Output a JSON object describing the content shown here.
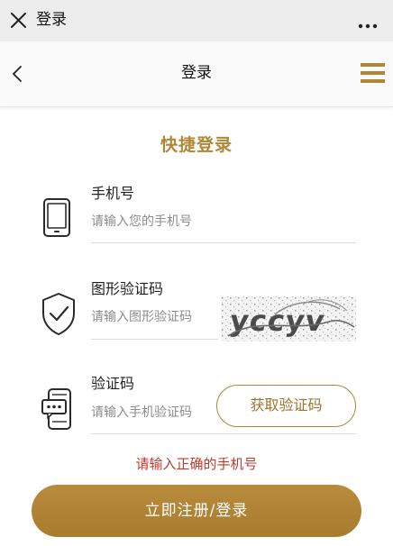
{
  "browser_bar": {
    "title": "登录",
    "close_icon": "close-icon",
    "more_icon": "more-icon"
  },
  "header": {
    "title": "登录",
    "back_icon": "back-icon",
    "menu_icon": "menu-icon"
  },
  "form": {
    "title": "快捷登录",
    "phone": {
      "label": "手机号",
      "placeholder": "请输入您的手机号",
      "icon": "phone-icon"
    },
    "captcha": {
      "label": "图形验证码",
      "placeholder": "请输入图形验证码",
      "icon": "shield-check-icon",
      "image_text": "yccyv"
    },
    "sms_code": {
      "label": "验证码",
      "placeholder": "请输入手机验证码",
      "icon": "phone-message-icon",
      "button_label": "获取验证码"
    },
    "error_message": "请输入正确的手机号",
    "submit_label": "立即注册/登录"
  },
  "colors": {
    "accent": "#b08637",
    "error": "#c0392b",
    "bar_bg": "#ededed"
  }
}
